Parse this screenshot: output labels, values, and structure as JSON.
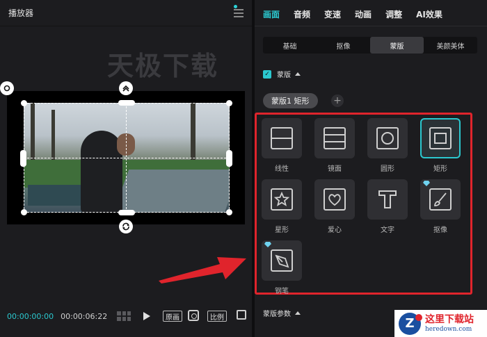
{
  "player": {
    "title": "播放器",
    "watermark": "天极下载",
    "time_current": "00:00:00:00",
    "time_total": "00:00:06:22",
    "btn_original": "原画",
    "btn_ratio": "比例"
  },
  "panel": {
    "tabs": [
      {
        "label": "画面",
        "active": true
      },
      {
        "label": "音频",
        "active": false
      },
      {
        "label": "变速",
        "active": false
      },
      {
        "label": "动画",
        "active": false
      },
      {
        "label": "调整",
        "active": false
      },
      {
        "label": "AI效果",
        "active": false
      }
    ],
    "subtabs": [
      {
        "label": "基础",
        "active": false
      },
      {
        "label": "抠像",
        "active": false
      },
      {
        "label": "蒙版",
        "active": true
      },
      {
        "label": "美颜美体",
        "active": false
      }
    ],
    "mask_section_label": "蒙版",
    "mask_chip_label": "蒙版1 矩形",
    "add_symbol": "+",
    "shapes": [
      {
        "label": "线性",
        "icon": "linear-mask-icon"
      },
      {
        "label": "镜面",
        "icon": "mirror-mask-icon"
      },
      {
        "label": "圆形",
        "icon": "circle-mask-icon"
      },
      {
        "label": "矩形",
        "icon": "rectangle-mask-icon",
        "selected": true
      },
      {
        "label": "星形",
        "icon": "star-mask-icon"
      },
      {
        "label": "爱心",
        "icon": "heart-mask-icon"
      },
      {
        "label": "文字",
        "icon": "text-mask-icon"
      },
      {
        "label": "抠像",
        "icon": "brush-mask-icon",
        "premium": true
      },
      {
        "label": "钢笔",
        "icon": "pen-mask-icon",
        "premium": true
      }
    ],
    "params_label": "蒙版参数"
  },
  "logo": {
    "cn": "这里下载站",
    "en": "heredown.com"
  },
  "colors": {
    "accent": "#2bc8cf",
    "highlight_red": "#e0242c",
    "panel_bg": "#1c1c1f"
  }
}
